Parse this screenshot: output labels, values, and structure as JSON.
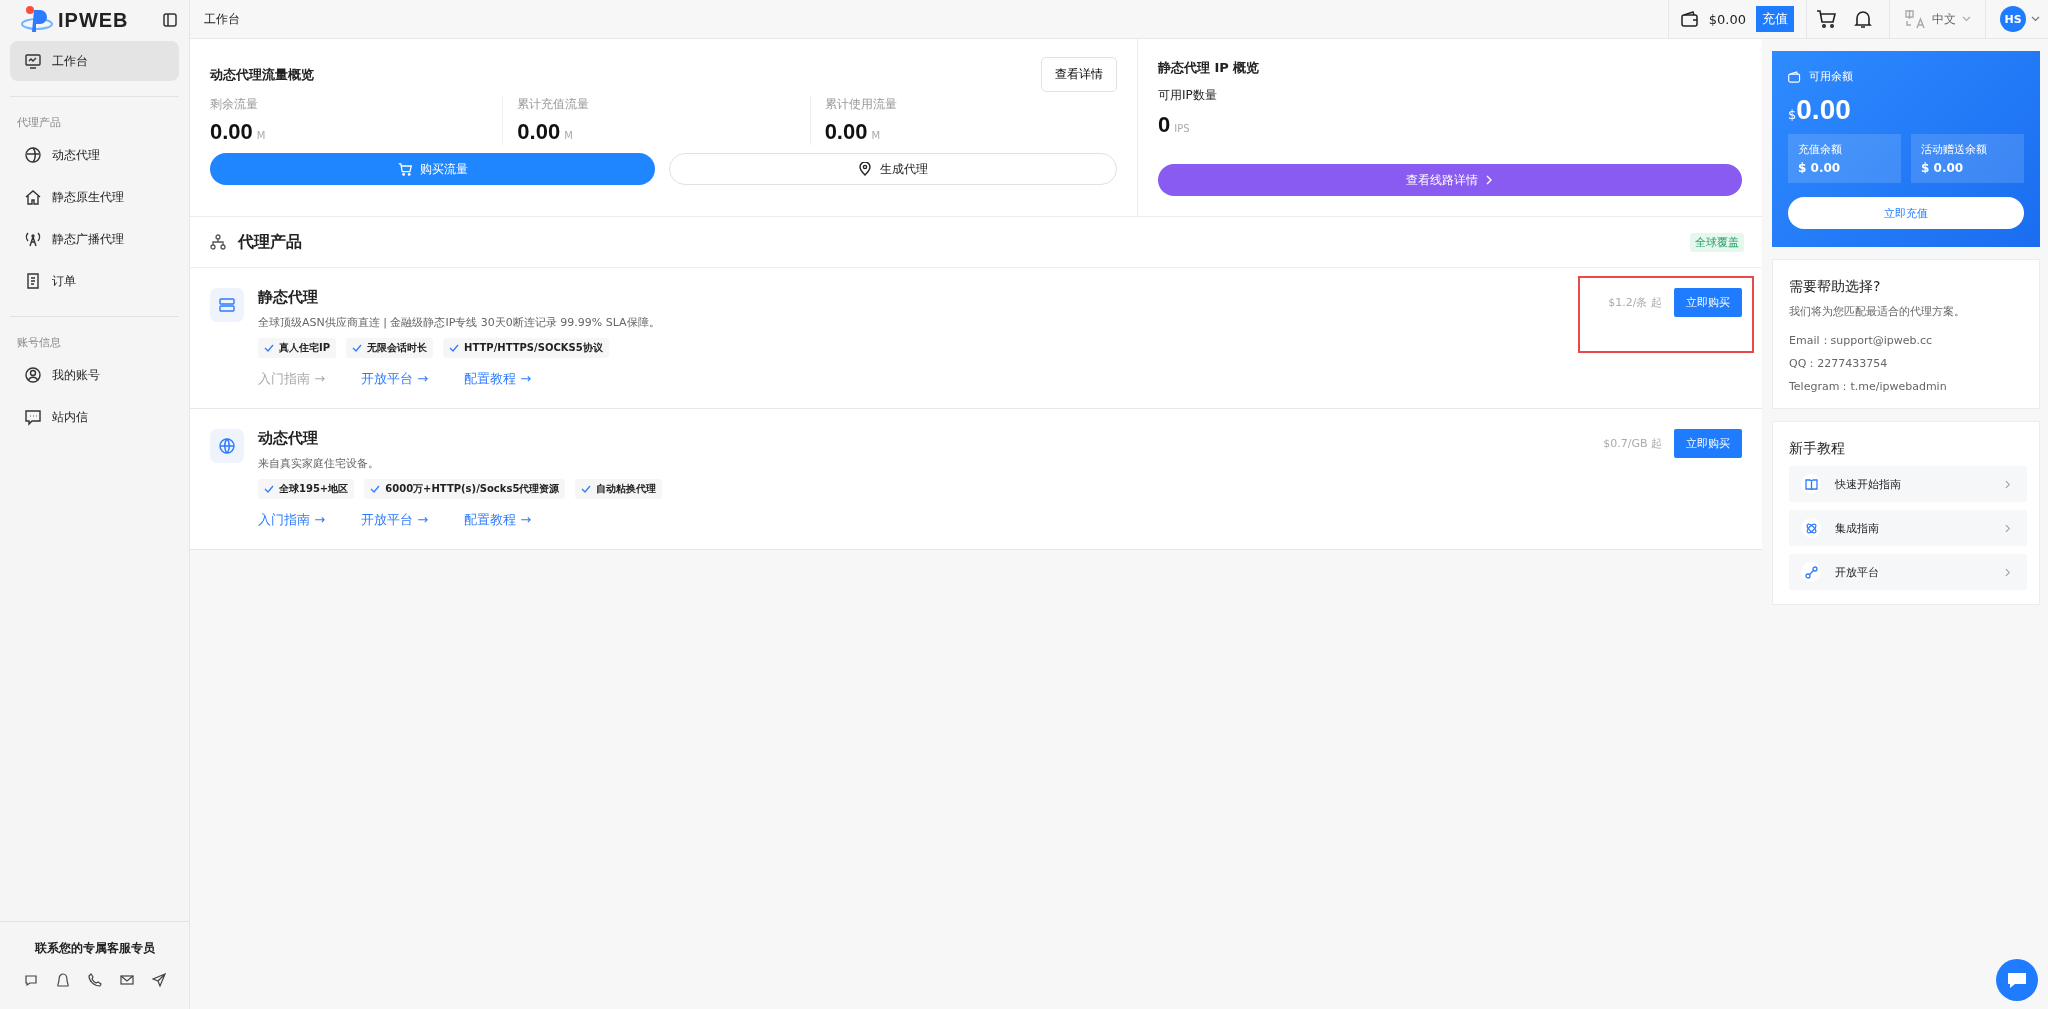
{
  "sidebar": {
    "logo": "IPWEB",
    "sections": [
      {
        "items": [
          {
            "label": "工作台",
            "selected": true
          }
        ]
      },
      {
        "title": "代理产品",
        "items": [
          {
            "label": "动态代理",
            "selected": false
          },
          {
            "label": "静态原生代理",
            "selected": false
          },
          {
            "label": "静态广播代理",
            "selected": false
          },
          {
            "label": "订单",
            "selected": false
          }
        ]
      },
      {
        "title": "账号信息",
        "items": [
          {
            "label": "我的账号",
            "selected": false
          },
          {
            "label": "站内信",
            "selected": false
          }
        ]
      }
    ],
    "contact_title": "联系您的专属客服专员"
  },
  "topbar": {
    "breadcrumb": "工作台",
    "balance": "$0.00",
    "recharge": "充值",
    "language": "中文",
    "avatar": "HS"
  },
  "dynamic_overview": {
    "title": "动态代理流量概览",
    "details_button": "查看详情",
    "stats": [
      {
        "label": "剩余流量",
        "value": "0.00",
        "unit": "M"
      },
      {
        "label": "累计充值流量",
        "value": "0.00",
        "unit": "M"
      },
      {
        "label": "累计使用流量",
        "value": "0.00",
        "unit": "M"
      }
    ],
    "buy_button": "购买流量",
    "generate_button": "生成代理"
  },
  "static_overview": {
    "title": "静态代理 IP 概览",
    "label": "可用IP数量",
    "value": "0",
    "unit": "IPS",
    "button": "查看线路详情"
  },
  "products": {
    "title": "代理产品",
    "badge": "全球覆盖",
    "items": [
      {
        "name": "静态代理",
        "description": "全球顶级ASN供应商直连 | 金融级静态IP专线 30天0断连记录 99.99% SLA保障。",
        "tags": [
          "真人住宅IP",
          "无限会话时长",
          "HTTP/HTTPS/SOCKS5协议"
        ],
        "links": [
          {
            "label": "入门指南 →",
            "disabled": true
          },
          {
            "label": "开放平台 →",
            "disabled": false
          },
          {
            "label": "配置教程 →",
            "disabled": false
          }
        ],
        "price": "$1.2/条 起",
        "buy": "立即购买",
        "highlighted": true
      },
      {
        "name": "动态代理",
        "description": "来自真实家庭住宅设备。",
        "tags": [
          "全球195+地区",
          "6000万+HTTP(s)/Socks5代理资源",
          "自动粘换代理"
        ],
        "links": [
          {
            "label": "入门指南 →",
            "disabled": false
          },
          {
            "label": "开放平台 →",
            "disabled": false
          },
          {
            "label": "配置教程 →",
            "disabled": false
          }
        ],
        "price": "$0.7/GB 起",
        "buy": "立即购买",
        "highlighted": false
      }
    ]
  },
  "balance": {
    "title": "可用余额",
    "currency": "$",
    "amount": "0.00",
    "parts": [
      {
        "label": "充值余额",
        "value": "$ 0.00"
      },
      {
        "label": "活动赠送余额",
        "value": "$ 0.00"
      }
    ],
    "button": "立即充值"
  },
  "help": {
    "title": "需要帮助选择?",
    "subtitle": "我们将为您匹配最适合的代理方案。",
    "lines": [
      "Email：support@ipweb.cc",
      "QQ：2277433754",
      "Telegram：t.me/ipwebadmin"
    ]
  },
  "tutorials": {
    "title": "新手教程",
    "items": [
      "快速开始指南",
      "集成指南",
      "开放平台"
    ]
  }
}
